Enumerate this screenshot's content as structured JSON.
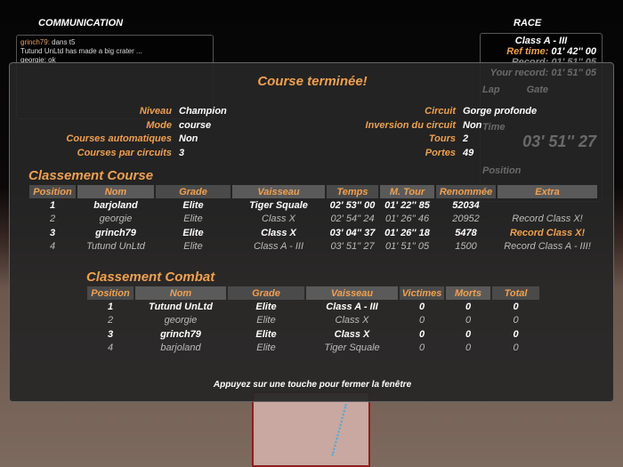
{
  "hud": {
    "communication_title": "COMMUNICATION",
    "chat": [
      {
        "name": "grinch79:",
        "text": " dans t5"
      },
      {
        "name": "",
        "text": "Tutund UnLtd has made a big crater ..."
      },
      {
        "name": "",
        "text": "georgie: ok"
      }
    ],
    "race_title": "RACE",
    "race_class": "Class A - III",
    "ref_time_label": "Ref time:",
    "ref_time": "01' 42'' 00",
    "record_label": "Record:",
    "record": "01' 51'' 05",
    "your_record_label": "Your record:",
    "your_record": "01' 51'' 05",
    "lap_label": "Lap",
    "gate_label": "Gate",
    "time_label": "Time",
    "time": "03' 51'' 27",
    "position_label": "Position"
  },
  "panel": {
    "title": "Course terminée!",
    "info_left": [
      {
        "label": "Niveau",
        "value": "Champion"
      },
      {
        "label": "Mode",
        "value": "course"
      },
      {
        "label": "Courses automatiques",
        "value": "Non"
      },
      {
        "label": "Courses par circuits",
        "value": "3"
      }
    ],
    "info_right": [
      {
        "label": "Circuit",
        "value": "Gorge profonde"
      },
      {
        "label": "Inversion du circuit",
        "value": "Non"
      },
      {
        "label": "Tours",
        "value": "2"
      },
      {
        "label": "Portes",
        "value": "49"
      }
    ],
    "course": {
      "title": "Classement Course",
      "headers": [
        "Position",
        "Nom",
        "Grade",
        "Vaisseau",
        "Temps",
        "M. Tour",
        "Renommée",
        "Extra"
      ],
      "rows": [
        [
          "1",
          "barjoland",
          "Elite",
          "Tiger Squale",
          "02' 53'' 00",
          "01' 22'' 85",
          "52034",
          ""
        ],
        [
          "2",
          "georgie",
          "Elite",
          "Class X",
          "02' 54'' 24",
          "01' 26'' 46",
          "20952",
          "Record Class X!"
        ],
        [
          "3",
          "grinch79",
          "Elite",
          "Class X",
          "03' 04'' 37",
          "01' 26'' 18",
          "5478",
          "Record Class X!"
        ],
        [
          "4",
          "Tutund UnLtd",
          "Elite",
          "Class A - III",
          "03' 51'' 27",
          "01' 51'' 05",
          "1500",
          "Record Class A - III!"
        ]
      ]
    },
    "combat": {
      "title": "Classement Combat",
      "headers": [
        "Position",
        "Nom",
        "Grade",
        "Vaisseau",
        "Victimes",
        "Morts",
        "Total"
      ],
      "rows": [
        [
          "1",
          "Tutund UnLtd",
          "Elite",
          "Class A - III",
          "0",
          "0",
          "0"
        ],
        [
          "2",
          "georgie",
          "Elite",
          "Class X",
          "0",
          "0",
          "0"
        ],
        [
          "3",
          "grinch79",
          "Elite",
          "Class X",
          "0",
          "0",
          "0"
        ],
        [
          "4",
          "barjoland",
          "Elite",
          "Tiger Squale",
          "0",
          "0",
          "0"
        ]
      ]
    },
    "footer": "Appuyez sur une touche pour fermer la fenêtre"
  },
  "colors": {
    "accent": "#f0a050",
    "panel": "#262626"
  }
}
